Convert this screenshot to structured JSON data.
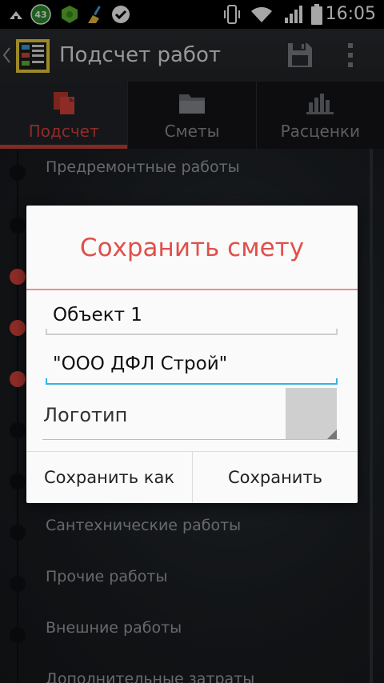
{
  "status_bar": {
    "notification_badge": "43",
    "time": "16:05"
  },
  "action_bar": {
    "title": "Подсчет работ"
  },
  "tabs": [
    {
      "label": "Подсчет",
      "active": true
    },
    {
      "label": "Сметы",
      "active": false
    },
    {
      "label": "Расценки",
      "active": false
    }
  ],
  "list": {
    "items": [
      "Предремонтные работы",
      "Сантехнические работы",
      "Прочие работы",
      "Внешние работы",
      "Дополнительные затраты"
    ]
  },
  "dialog": {
    "title": "Сохранить смету",
    "object_value": "Объект 1",
    "company_value": "\"ООО ДФЛ Строй\"",
    "logo_label": "Логотип",
    "save_as_label": "Сохранить как",
    "save_label": "Сохранить"
  },
  "colors": {
    "accent_red": "#d9443c",
    "focus_blue": "#33b5e5",
    "dialog_title": "#e0504a"
  }
}
